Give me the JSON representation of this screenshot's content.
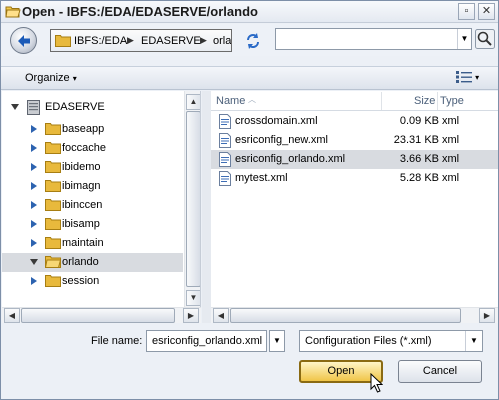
{
  "window": {
    "title": "Open - IBFS:/EDA/EDASERVE/orlando",
    "minimize": "▫",
    "close": "✕"
  },
  "address": {
    "crumbs": [
      "IBFS:/EDA",
      "EDASERVE",
      "orla"
    ],
    "search_value": ""
  },
  "toolbar": {
    "organize_label": "Organize",
    "organize_arrow": "▾",
    "views_arrow": "▾"
  },
  "tree": {
    "root": "EDASERVE",
    "items": [
      {
        "label": "baseapp"
      },
      {
        "label": "foccache"
      },
      {
        "label": "ibidemo"
      },
      {
        "label": "ibimagn"
      },
      {
        "label": "ibinccen"
      },
      {
        "label": "ibisamp"
      },
      {
        "label": "maintain"
      },
      {
        "label": "orlando",
        "selected": true
      },
      {
        "label": "session"
      }
    ]
  },
  "files": {
    "columns": {
      "name": "Name",
      "size": "Size",
      "type": "Type"
    },
    "rows": [
      {
        "name": "crossdomain.xml",
        "size": "0.09 KB",
        "type": "xml"
      },
      {
        "name": "esriconfig_new.xml",
        "size": "23.31 KB",
        "type": "xml"
      },
      {
        "name": "esriconfig_orlando.xml",
        "size": "3.66 KB",
        "type": "xml",
        "selected": true
      },
      {
        "name": "mytest.xml",
        "size": "5.28 KB",
        "type": "xml"
      }
    ]
  },
  "footer": {
    "filename_label": "File name:",
    "filename_value": "esriconfig_orlando.xml",
    "filter_value": "Configuration Files (*.xml)",
    "open_label": "Open",
    "cancel_label": "Cancel"
  },
  "icons": {
    "folder": "folder-icon",
    "file": "xml-file-icon",
    "server": "server-icon",
    "back": "back-arrow-icon",
    "refresh": "refresh-icon",
    "search": "search-icon",
    "views": "views-icon"
  },
  "colors": {
    "selection": "#d8dbe0",
    "open_button": "#f0c548",
    "folder": "#e8b93c"
  }
}
